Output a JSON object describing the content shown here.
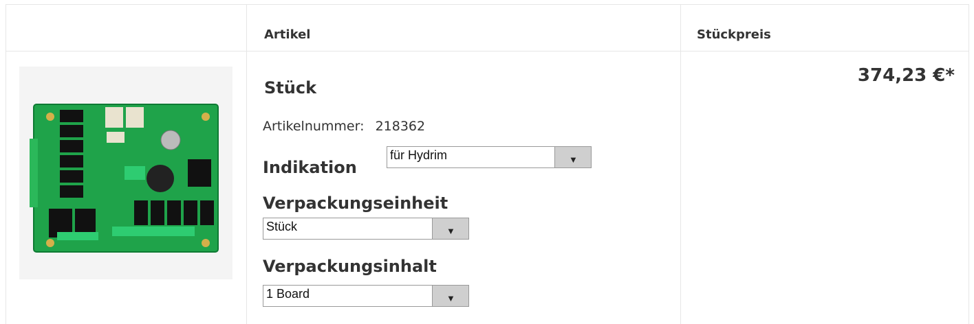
{
  "header": {
    "col_article": "Artikel",
    "col_unit_price": "Stückpreis"
  },
  "item": {
    "title": "Stück",
    "article_number_label": "Artikelnummer:",
    "article_number": "218362",
    "indication_label": "Indikation",
    "indication_value": "für Hydrim",
    "packaging_unit_label": "Verpackungseinheit",
    "packaging_unit_value": "Stück",
    "packaging_content_label": "Verpackungsinhalt",
    "packaging_content_value": "1 Board",
    "price": "374,23 €*",
    "image_alt": "circuit-board-product-image"
  },
  "icons": {
    "dropdown": "chevron-down-icon"
  },
  "colors": {
    "border": "#e6e6e6",
    "pcb_green": "#1fa34a",
    "select_button": "#cfcfcf"
  }
}
